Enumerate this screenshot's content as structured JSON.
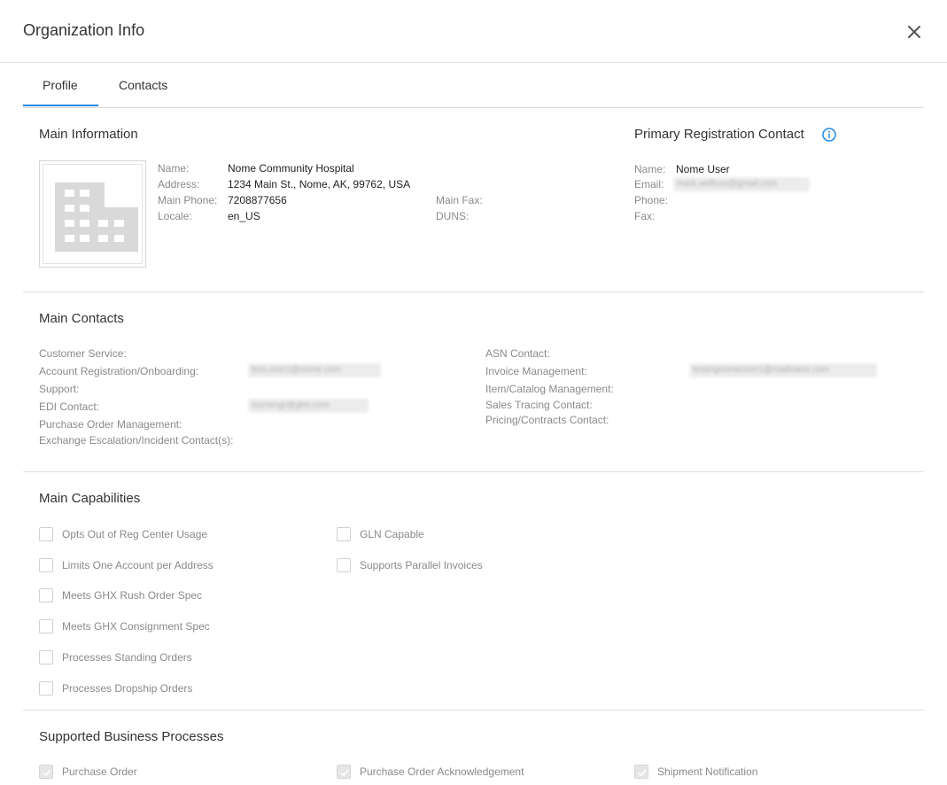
{
  "dialog": {
    "title": "Organization Info"
  },
  "tabs": [
    {
      "label": "Profile",
      "active": true
    },
    {
      "label": "Contacts",
      "active": false
    }
  ],
  "main_info": {
    "heading": "Main Information",
    "name_label": "Name:",
    "name": "Nome Community Hospital",
    "address_label": "Address:",
    "address": "1234 Main St., Nome, AK, 99762, USA",
    "phone_label": "Main Phone:",
    "phone": "7208877656",
    "locale_label": "Locale:",
    "locale": "en_US",
    "fax_label": "Main Fax:",
    "fax": "",
    "duns_label": "DUNS:",
    "duns": ""
  },
  "primary_contact": {
    "heading": "Primary Registration Contact",
    "name_label": "Name:",
    "name": "Nome User",
    "email_label": "Email:",
    "email": "mark.wellcox@gmail.com",
    "phone_label": "Phone:",
    "phone": "",
    "fax_label": "Fax:",
    "fax": ""
  },
  "main_contacts": {
    "heading": "Main Contacts",
    "left": [
      {
        "label": "Customer Service:",
        "value": ""
      },
      {
        "label": "Account Registration/Onboarding:",
        "value": "test.user1@nome.com"
      },
      {
        "label": "Support:",
        "value": ""
      },
      {
        "label": "EDI Contact:",
        "value": "nomengr@ghx.com"
      },
      {
        "label": "Purchase Order Management:",
        "value": ""
      },
      {
        "label": "Exchange Escalation/Incident Contact(s):",
        "value": ""
      }
    ],
    "right": [
      {
        "label": "ASN Contact:",
        "value": ""
      },
      {
        "label": "Invoice Management:",
        "value": "testingnomeuser1@mailinator.com"
      },
      {
        "label": "Item/Catalog Management:",
        "value": ""
      },
      {
        "label": "Sales Tracing Contact:",
        "value": ""
      },
      {
        "label": "Pricing/Contracts Contact:",
        "value": ""
      }
    ]
  },
  "capabilities": {
    "heading": "Main Capabilities",
    "col1": [
      {
        "label": "Opts Out of Reg Center Usage",
        "checked": false
      },
      {
        "label": "Limits One Account per Address",
        "checked": false
      },
      {
        "label": "Meets GHX Rush Order Spec",
        "checked": false
      },
      {
        "label": "Meets GHX Consignment Spec",
        "checked": false
      },
      {
        "label": "Processes Standing Orders",
        "checked": false
      },
      {
        "label": "Processes Dropship Orders",
        "checked": false
      }
    ],
    "col2": [
      {
        "label": "GLN Capable",
        "checked": false
      },
      {
        "label": "Supports Parallel Invoices",
        "checked": false
      }
    ]
  },
  "business_processes": {
    "heading": "Supported Business Processes",
    "items": [
      {
        "label": "Purchase Order",
        "checked": true
      },
      {
        "label": "Purchase Order Acknowledgement",
        "checked": true
      },
      {
        "label": "Shipment Notification",
        "checked": true
      }
    ]
  },
  "colors": {
    "accent": "#1e88e5",
    "label": "#8a8a8a",
    "text": "#222222",
    "divider": "#e0e0e0"
  }
}
